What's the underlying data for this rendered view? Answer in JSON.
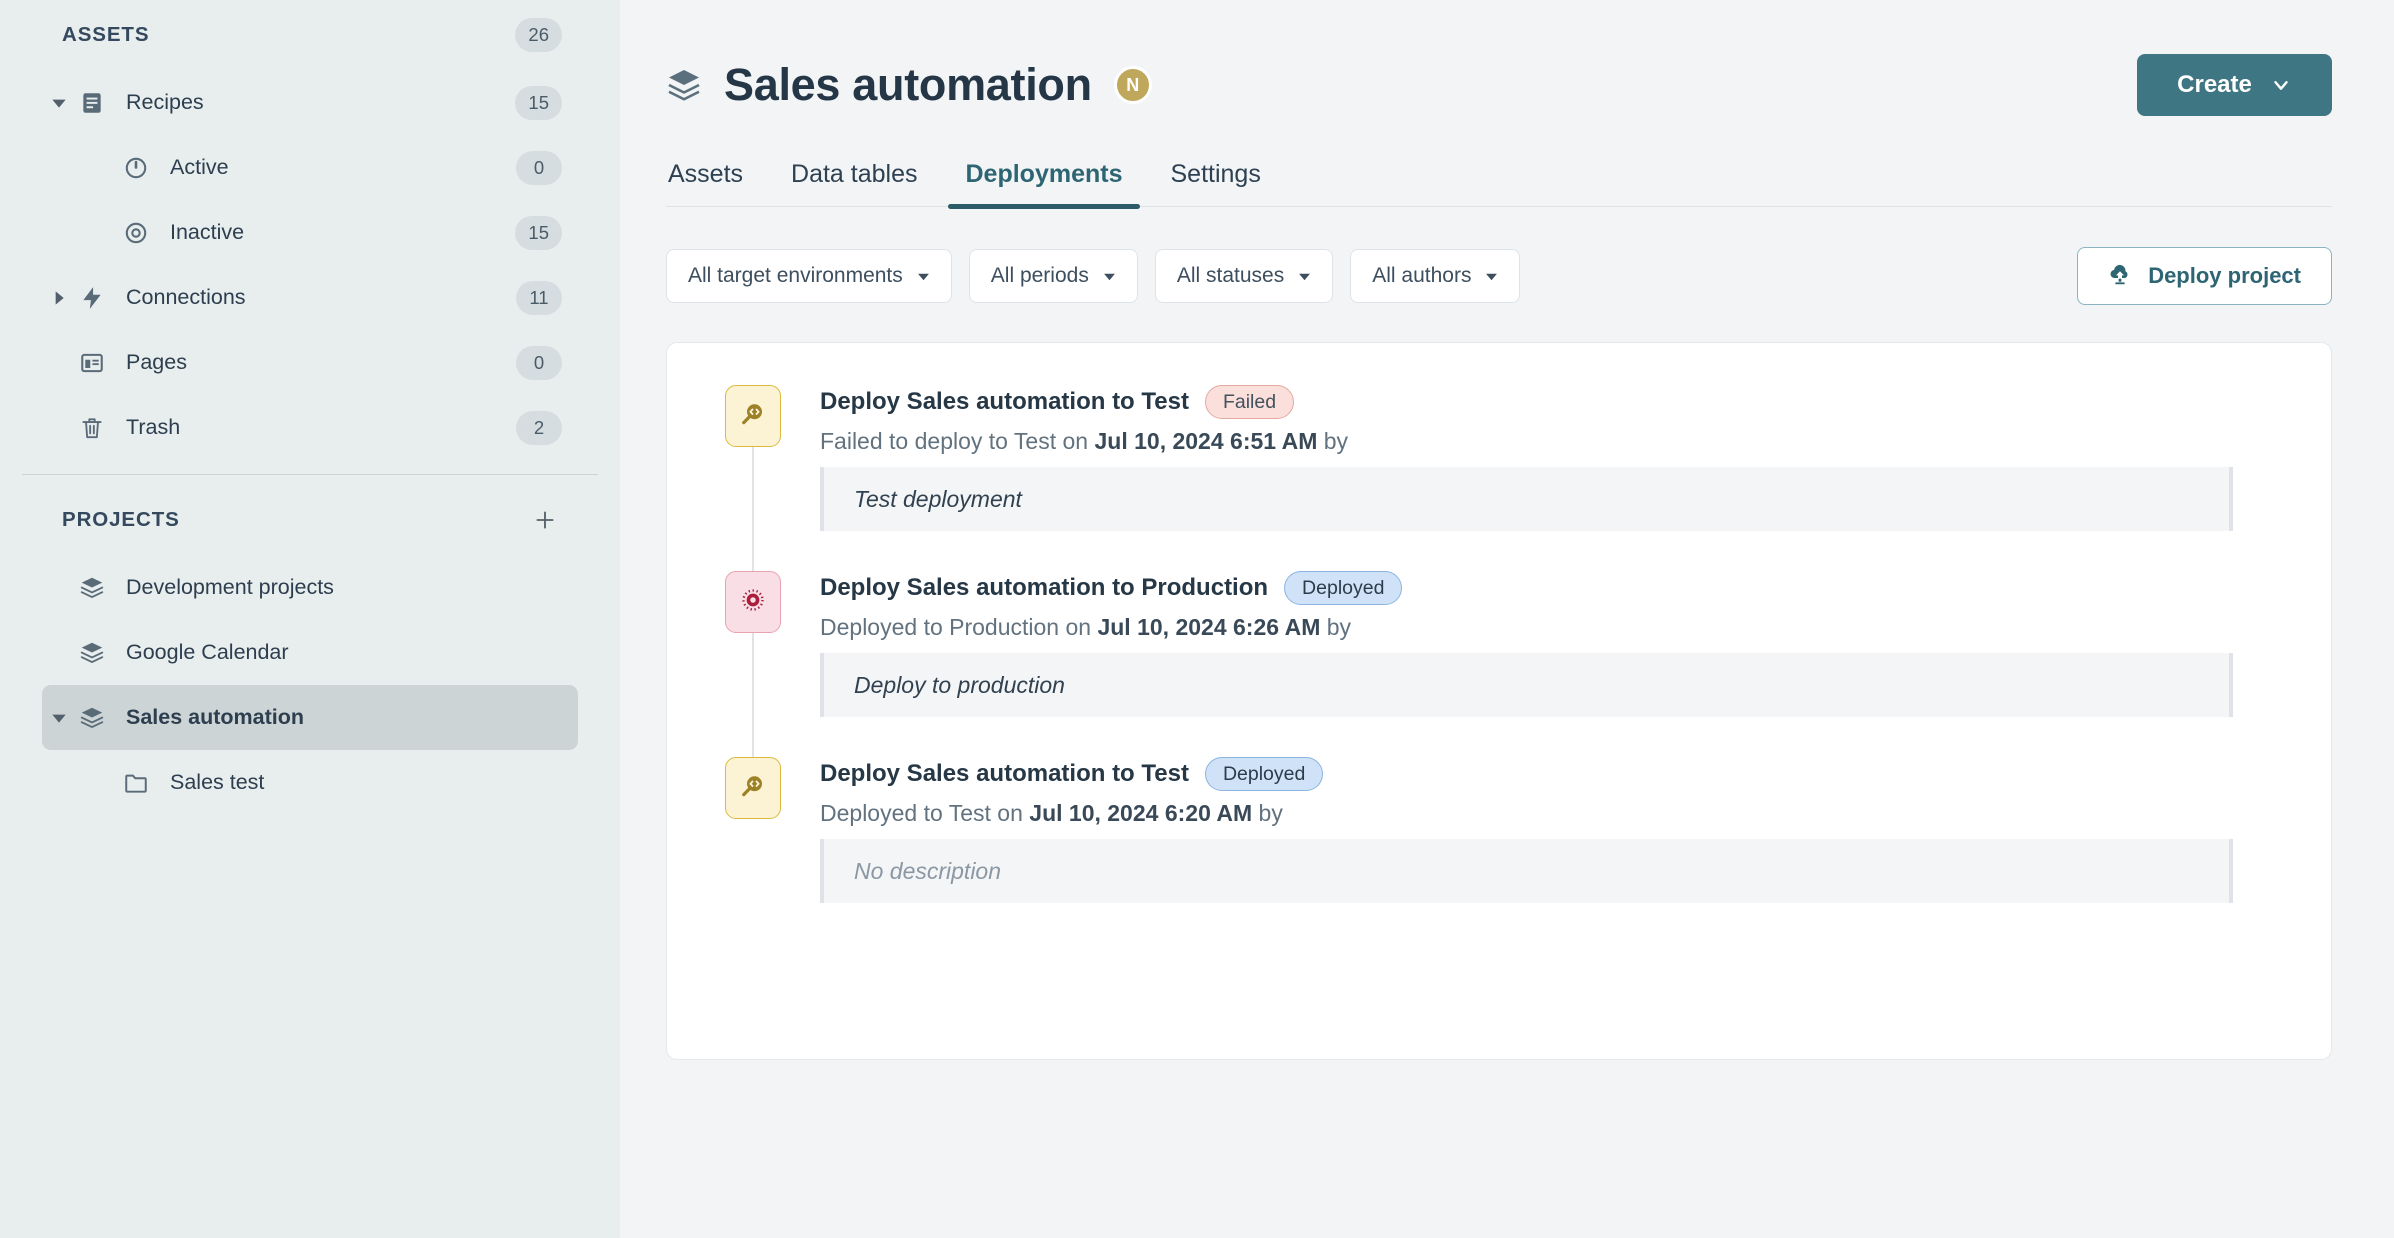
{
  "sidebar": {
    "assets": {
      "label": "ASSETS",
      "count": "26",
      "items": [
        {
          "label": "Recipes",
          "count": "15",
          "icon": "recipes-icon",
          "caret": "down",
          "indent": 0
        },
        {
          "label": "Active",
          "count": "0",
          "icon": "active-icon",
          "caret": "none",
          "indent": 1
        },
        {
          "label": "Inactive",
          "count": "15",
          "icon": "inactive-icon",
          "caret": "none",
          "indent": 1
        },
        {
          "label": "Connections",
          "count": "11",
          "icon": "connections-icon",
          "caret": "right",
          "indent": 0
        },
        {
          "label": "Pages",
          "count": "0",
          "icon": "pages-icon",
          "caret": "none",
          "indent": 0
        },
        {
          "label": "Trash",
          "count": "2",
          "icon": "trash-icon",
          "caret": "none",
          "indent": 0
        }
      ]
    },
    "projects": {
      "label": "PROJECTS",
      "add_label": "+",
      "items": [
        {
          "label": "Development projects",
          "icon": "project-icon",
          "caret": "none",
          "selected": false,
          "indent": 0
        },
        {
          "label": "Google Calendar",
          "icon": "project-icon",
          "caret": "none",
          "selected": false,
          "indent": 0
        },
        {
          "label": "Sales automation",
          "icon": "project-icon",
          "caret": "down",
          "selected": true,
          "indent": 0
        },
        {
          "label": "Sales test",
          "icon": "folder-icon",
          "caret": "none",
          "selected": false,
          "indent": 1
        }
      ]
    }
  },
  "header": {
    "title": "Sales automation",
    "title_icon": "project-icon",
    "avatar_initial": "N",
    "avatar_color": "#bfa85c",
    "create_label": "Create",
    "create_color": "#3f7684"
  },
  "tabs": [
    {
      "label": "Assets",
      "active": false
    },
    {
      "label": "Data tables",
      "active": false
    },
    {
      "label": "Deployments",
      "active": true
    },
    {
      "label": "Settings",
      "active": false
    }
  ],
  "filters": {
    "items": [
      {
        "label": "All target environments"
      },
      {
        "label": "All periods"
      },
      {
        "label": "All statuses"
      },
      {
        "label": "All authors"
      }
    ],
    "deploy_label": "Deploy project",
    "deploy_icon": "cloud-upload-icon",
    "accent_color": "#2d6573"
  },
  "deployments": [
    {
      "title": "Deploy Sales automation to Test",
      "status": "Failed",
      "status_kind": "failed",
      "env_kind": "test",
      "env_icon": "code-search-icon",
      "sub_prefix": "Failed to deploy to Test on ",
      "sub_date": "Jul 10, 2024 6:51 AM",
      "sub_suffix": " by",
      "description": "Test deployment",
      "description_empty": false
    },
    {
      "title": "Deploy Sales automation to Production",
      "status": "Deployed",
      "status_kind": "deployed",
      "env_kind": "prod",
      "env_icon": "production-target-icon",
      "sub_prefix": "Deployed to Production on ",
      "sub_date": "Jul 10, 2024 6:26 AM",
      "sub_suffix": " by",
      "description": "Deploy to production",
      "description_empty": false
    },
    {
      "title": "Deploy Sales automation to Test",
      "status": "Deployed",
      "status_kind": "deployed",
      "env_kind": "test",
      "env_icon": "code-search-icon",
      "sub_prefix": "Deployed to Test on ",
      "sub_date": "Jul 10, 2024 6:20 AM",
      "sub_suffix": " by",
      "description": "No description",
      "description_empty": true
    }
  ]
}
